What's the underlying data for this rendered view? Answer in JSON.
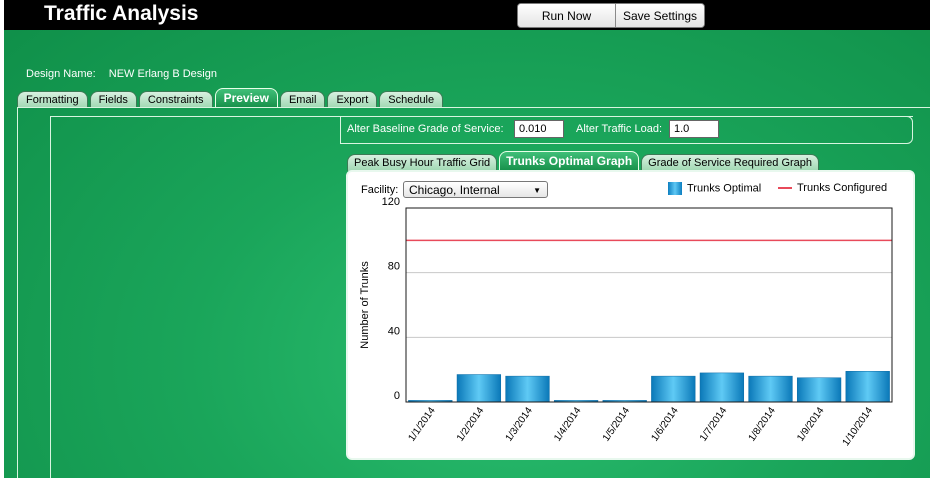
{
  "app": {
    "title": "Traffic Analysis"
  },
  "toolbar": {
    "run_label": "Run Now",
    "save_label": "Save Settings"
  },
  "design": {
    "label": "Design Name:",
    "value": "NEW Erlang B Design"
  },
  "tabs": [
    {
      "label": "Formatting"
    },
    {
      "label": "Fields"
    },
    {
      "label": "Constraints"
    },
    {
      "label": "Preview",
      "active": true
    },
    {
      "label": "Email"
    },
    {
      "label": "Export"
    },
    {
      "label": "Schedule"
    }
  ],
  "alter": {
    "gos_label": "Alter Baseline Grade of Service:",
    "gos_value": "0.010",
    "load_label": "Alter Traffic Load:",
    "load_value": "1.0"
  },
  "graph_tabs": [
    {
      "label": "Peak Busy Hour Traffic Grid"
    },
    {
      "label": "Trunks Optimal Graph",
      "active": true
    },
    {
      "label": "Grade of Service Required Graph"
    }
  ],
  "facility": {
    "label": "Facility:",
    "value": "Chicago, Internal"
  },
  "colors": {
    "bar": "#1a9be0",
    "configured": "#e84a5a",
    "accent": "#1aa55a"
  },
  "chart_data": {
    "type": "bar",
    "categories": [
      "1/1/2014",
      "1/2/2014",
      "1/3/2014",
      "1/4/2014",
      "1/5/2014",
      "1/6/2014",
      "1/7/2014",
      "1/8/2014",
      "1/9/2014",
      "1/10/2014"
    ],
    "series": [
      {
        "name": "Trunks Optimal",
        "type": "bar",
        "values": [
          1,
          17,
          16,
          1,
          1,
          16,
          18,
          16,
          15,
          19
        ]
      },
      {
        "name": "Trunks Configured",
        "type": "line",
        "values": [
          100,
          100,
          100,
          100,
          100,
          100,
          100,
          100,
          100,
          100
        ]
      }
    ],
    "ylabel": "Number of Trunks",
    "xlabel": "",
    "ylim": [
      0,
      120
    ],
    "yticks": [
      0,
      40,
      80,
      120
    ],
    "grid": true,
    "legend": "top-right"
  }
}
